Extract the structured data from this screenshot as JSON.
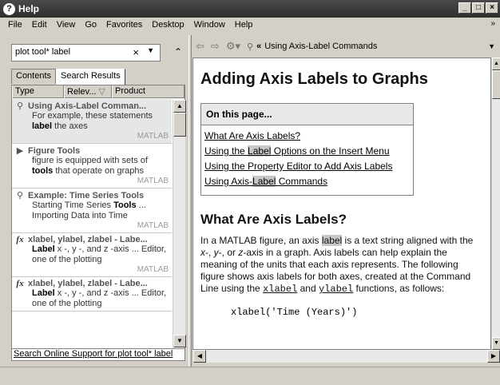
{
  "window": {
    "title": "Help",
    "minimize": "_",
    "maximize": "□",
    "close": "×"
  },
  "menu": {
    "items": [
      "File",
      "Edit",
      "View",
      "Go",
      "Favorites",
      "Desktop",
      "Window",
      "Help"
    ],
    "more": "»"
  },
  "search": {
    "value": "plot tool* label",
    "clear": "×"
  },
  "tabs": [
    "Contents",
    "Search Results"
  ],
  "columns": {
    "type": "Type",
    "relevance": "Relev...",
    "product": "Product"
  },
  "results": [
    {
      "icon": "help-icon",
      "title": "Using Axis-Label Comman...",
      "snippet_pre": "For example, these statements ",
      "snippet_bold": "label",
      "snippet_post": " the axes",
      "product": "MATLAB"
    },
    {
      "icon": "page-icon",
      "title": "Figure Tools",
      "snippet_pre": "figure is equipped with sets of ",
      "snippet_bold": "tools",
      "snippet_post": " that operate on graphs",
      "product": "MATLAB"
    },
    {
      "icon": "help-icon",
      "title": "Example: Time Series Tools",
      "snippet_pre": "Starting Time Series ",
      "snippet_bold": "Tools",
      "snippet_post": " ... Importing Data into Time",
      "product": "MATLAB"
    },
    {
      "icon": "fx-icon",
      "title": "xlabel, ylabel, zlabel - Labe...",
      "snippet_pre": "",
      "snippet_bold": "Label",
      "snippet_post": " x -, y -, and z -axis ... Editor, one of the plotting",
      "product": "MATLAB"
    },
    {
      "icon": "fx-icon",
      "title": "xlabel, ylabel, zlabel - Labe...",
      "snippet_pre": "",
      "snippet_bold": "Label",
      "snippet_post": " x -, y -, and z -axis ... Editor, one of the plotting",
      "product": ""
    }
  ],
  "online_search": "Search Online Support for plot tool* label",
  "navbar": {
    "back": "⇦",
    "forward": "⇨",
    "gear": "⚙▾",
    "breadcrumb_arrow": "«",
    "breadcrumb": "Using Axis-Label Commands"
  },
  "content": {
    "title": "Adding Axis Labels to Graphs",
    "on_this_page": "On this page...",
    "links": [
      {
        "pre": "What Are Axis Labels?",
        "hl": "",
        "post": ""
      },
      {
        "pre": "Using the ",
        "hl": "Label",
        "post": " Options on the Insert Menu"
      },
      {
        "pre": "Using the Property Editor to Add Axis Labels",
        "hl": "",
        "post": ""
      },
      {
        "pre": "Using Axis-",
        "hl": "Label",
        "post": " Commands"
      }
    ],
    "section_title": "What Are Axis Labels?",
    "para_1": "In a MATLAB figure, an axis ",
    "para_hl": "label",
    "para_2": " is a text string aligned with the ",
    "para_x": "x",
    "para_3": "-, ",
    "para_y": "y",
    "para_4": "-, or ",
    "para_z": "z",
    "para_5": "-axis in a graph. Axis labels can help explain the meaning of the units that each axis represents. The following figure shows axis labels for both axes, created at the Command Line using the ",
    "code_x": "xlabel",
    "para_6": " and ",
    "code_y": "ylabel",
    "para_7": " functions, as follows:",
    "code_line": "xlabel('Time (Years)')"
  }
}
